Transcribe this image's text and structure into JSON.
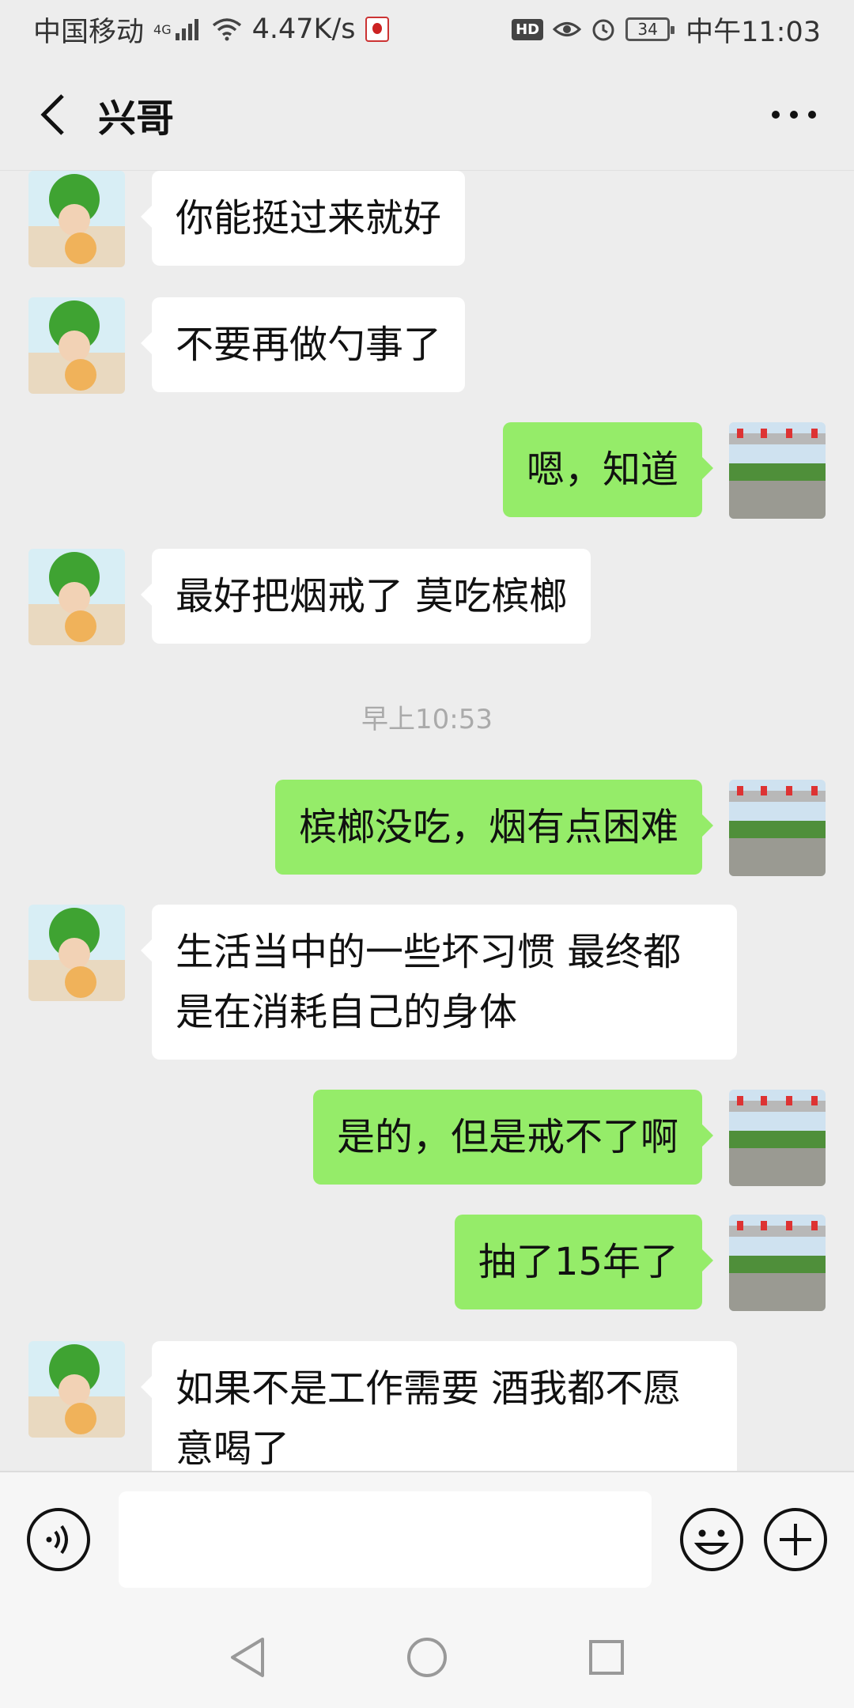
{
  "status_bar": {
    "carrier": "中国移动",
    "network": "4G",
    "speed": "4.47K/s",
    "hd_badge": "HD",
    "battery": "34",
    "time": "中午11:03"
  },
  "header": {
    "title": "兴哥",
    "back_icon": "chevron-left-icon",
    "more_icon": "more-dots-icon"
  },
  "messages": [
    {
      "side": "left",
      "text": "你能挺过来就好"
    },
    {
      "side": "left",
      "text": "不要再做勺事了"
    },
    {
      "side": "right",
      "text": "嗯，知道"
    },
    {
      "side": "left",
      "text": "最好把烟戒了  莫吃槟榔"
    },
    {
      "side": "right",
      "text": "槟榔没吃，烟有点困难"
    },
    {
      "side": "left",
      "text": "生活当中的一些坏习惯  最终都是在消耗自己的身体"
    },
    {
      "side": "right",
      "text": "是的，但是戒不了啊"
    },
    {
      "side": "right",
      "text": "抽了15年了"
    },
    {
      "side": "left",
      "text": "如果不是工作需要  酒我都不愿意喝了"
    }
  ],
  "timestamp": "早上10:53",
  "input": {
    "value": "",
    "voice_icon": "voice-icon",
    "emoji_icon": "emoji-icon",
    "plus_icon": "plus-icon"
  },
  "nav": {
    "back_icon": "nav-back-icon",
    "home_icon": "nav-home-icon",
    "recents_icon": "nav-recents-icon"
  },
  "colors": {
    "background": "#ededed",
    "sent_bubble": "#95ec69",
    "received_bubble": "#ffffff"
  }
}
